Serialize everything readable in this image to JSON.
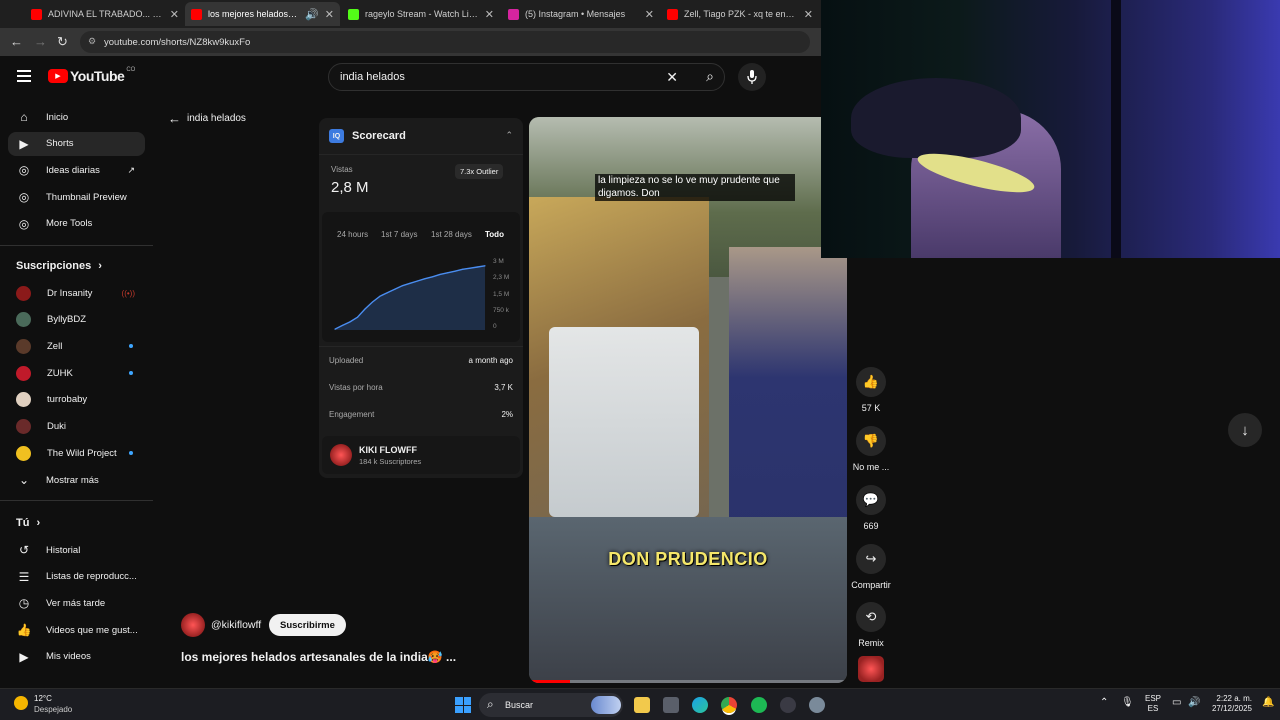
{
  "tabs": [
    {
      "title": "ADIVINA EL TRABADO... - YouTube",
      "color": "#ff0000"
    },
    {
      "title": "los mejores helados artesanales",
      "color": "#ff0000"
    },
    {
      "title": "rageylo Stream - Watch Live on Kick",
      "color": "#53fc18"
    },
    {
      "title": "(5) Instagram • Mensajes",
      "color": "#d6249f"
    },
    {
      "title": "Zell, Tiago PZK - xq te enamoraste",
      "color": "#ff0000"
    }
  ],
  "address": {
    "url": "youtube.com/shorts/NZ8kw9kuxFo"
  },
  "header": {
    "logo": "YouTube",
    "country": "CO",
    "search_value": "india helados"
  },
  "sidebar": {
    "main": [
      {
        "label": "Inicio",
        "icon": "home-icon"
      },
      {
        "label": "Shorts",
        "icon": "shorts-icon"
      },
      {
        "label": "Ideas diarias",
        "icon": "ideas-icon"
      },
      {
        "label": "Thumbnail Preview",
        "icon": "thumbnail-icon"
      },
      {
        "label": "More Tools",
        "icon": "tools-icon"
      }
    ],
    "subs_title": "Suscripciones",
    "subs": [
      {
        "label": "Dr Insanity",
        "color": "#8b1a1a"
      },
      {
        "label": "ByllyBDZ",
        "color": "#4a6a5a"
      },
      {
        "label": "Zell",
        "color": "#5a3a2a"
      },
      {
        "label": "ZUHK",
        "color": "#c01a2a"
      },
      {
        "label": "turrobaby",
        "color": "#e0d0c0"
      },
      {
        "label": "Duki",
        "color": "#6a2a2a"
      },
      {
        "label": "The Wild Project",
        "color": "#f0c020"
      }
    ],
    "more_label": "Mostrar más",
    "you_title": "Tú",
    "you": [
      {
        "label": "Historial",
        "icon": "history-icon"
      },
      {
        "label": "Listas de reproducc...",
        "icon": "playlist-icon"
      },
      {
        "label": "Ver más tarde",
        "icon": "clock-icon"
      },
      {
        "label": "Videos que me gust...",
        "icon": "thumbs-up-icon"
      },
      {
        "label": "Mis videos",
        "icon": "video-icon"
      }
    ]
  },
  "back_label": "india helados",
  "scorecard": {
    "title": "Scorecard",
    "views_label": "Vistas",
    "views_value": "2,8 M",
    "outlier": "7.3x Outlier",
    "ranges": [
      "24 hours",
      "1st 7 days",
      "1st 28 days",
      "Todo"
    ],
    "y_ticks": [
      "3 M",
      "2,3 M",
      "1,5 M",
      "750 k",
      "0"
    ],
    "rows": [
      {
        "label": "Uploaded",
        "value": "a month ago"
      },
      {
        "label": "Vistas por hora",
        "value": "3,7 K"
      },
      {
        "label": "Engagement",
        "value": "2%"
      }
    ],
    "channel_name": "KIKI FLOWFF",
    "channel_subs": "184 k Suscriptores"
  },
  "chart_data": {
    "type": "area",
    "x": [
      0,
      5,
      10,
      15,
      20,
      25,
      30,
      35,
      40,
      45,
      50,
      55,
      60,
      65,
      70,
      75,
      80,
      85,
      90,
      95,
      100
    ],
    "values": [
      0.04,
      0.2,
      0.35,
      0.55,
      0.9,
      1.2,
      1.45,
      1.6,
      1.75,
      1.9,
      2.0,
      2.1,
      2.2,
      2.28,
      2.38,
      2.45,
      2.52,
      2.6,
      2.65,
      2.7,
      2.75
    ],
    "ylim": [
      0,
      3
    ],
    "y_unit": "M"
  },
  "video": {
    "caption": "la limpieza no se lo ve muy prudente que digamos. Don",
    "overlay": "DON PRUDENCIO",
    "channel": "@kikiflowff",
    "subscribe": "Suscribirme",
    "title": "los mejores helados artesanales de la india🥵 ...",
    "progress": 0.13
  },
  "actions": [
    {
      "label": "57 K",
      "icon": "like-icon",
      "glyph": "👍"
    },
    {
      "label": "No me ...",
      "icon": "dislike-icon",
      "glyph": "👎"
    },
    {
      "label": "669",
      "icon": "comment-icon",
      "glyph": "💬"
    },
    {
      "label": "Compartir",
      "icon": "share-icon",
      "glyph": "↪"
    },
    {
      "label": "Remix",
      "icon": "remix-icon",
      "glyph": "⟲"
    }
  ],
  "taskbar": {
    "weather_temp": "12°C",
    "weather_desc": "Despejado",
    "search": "Buscar",
    "lang1": "ESP",
    "lang2": "ES",
    "time": "2:22 a. m.",
    "date": "27/12/2025"
  }
}
